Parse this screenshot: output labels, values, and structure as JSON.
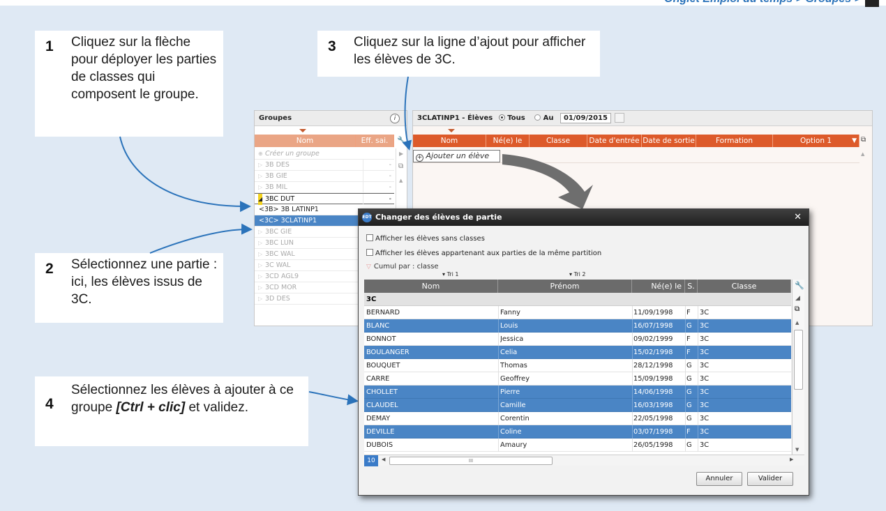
{
  "header": {
    "breadcrumb": "Onglet Emploi du temps > Groupes >"
  },
  "callouts": [
    {
      "num": "1",
      "text": "Cliquez sur la flèche pour déployer les parties de classes qui composent le groupe."
    },
    {
      "num": "2",
      "text": "Sélectionnez une partie : ici, les élèves issus de 3C."
    },
    {
      "num": "3",
      "text": "Cliquez sur la ligne d’ajout pour afficher les élèves de 3C."
    },
    {
      "num": "4",
      "text_before": "Sélectionnez les élèves à ajouter à ce groupe ",
      "text_bold": "[Ctrl + clic]",
      "text_after": " et validez."
    }
  ],
  "groups_panel": {
    "title": "Groupes",
    "col_nom": "Nom",
    "col_eff": "Eff. sai.",
    "create": "Créer un groupe",
    "rows": [
      {
        "name": "3B DES",
        "eff": "-"
      },
      {
        "name": "3B GIE",
        "eff": "-"
      },
      {
        "name": "3B MIL",
        "eff": "-"
      },
      {
        "name": "3BC DUT",
        "eff": "-"
      },
      {
        "name": "<3B> 3B  LATINP1",
        "eff": ""
      },
      {
        "name": "<3C> 3CLATINP1",
        "eff": ""
      },
      {
        "name": "3BC GIE",
        "eff": ""
      },
      {
        "name": "3BC LUN",
        "eff": ""
      },
      {
        "name": "3BC WAL",
        "eff": ""
      },
      {
        "name": "3C WAL",
        "eff": ""
      },
      {
        "name": "3CD AGL9",
        "eff": ""
      },
      {
        "name": "3CD MOR",
        "eff": ""
      },
      {
        "name": "3D DES",
        "eff": ""
      }
    ]
  },
  "students_panel": {
    "title": "3CLATINP1 - Élèves",
    "radio_tous": "Tous",
    "radio_au": "Au",
    "date": "01/09/2015",
    "columns": [
      "Nom",
      "Né(e) le",
      "Classe",
      "Date d'entrée",
      "Date de sortie",
      "Formation",
      "Option 1"
    ],
    "add_row": "Ajouter un élève"
  },
  "dialog": {
    "title": "Changer des élèves de partie",
    "logo": "EDT",
    "check1": "Afficher les élèves sans classes",
    "check2": "Afficher les élèves appartenant aux parties de la même partition",
    "cumul": "Cumul par : classe",
    "tri1": "Tri 1",
    "tri2": "Tri 2",
    "columns": [
      "Nom",
      "Prénom",
      "Né(e) le",
      "S.",
      "Classe"
    ],
    "group_label": "3C",
    "rows": [
      {
        "nom": "BERNARD",
        "prenom": "Fanny",
        "ne": "11/09/1998",
        "s": "F",
        "classe": "3C",
        "selected": false
      },
      {
        "nom": "BLANC",
        "prenom": "Louis",
        "ne": "16/07/1998",
        "s": "G",
        "classe": "3C",
        "selected": true
      },
      {
        "nom": "BONNOT",
        "prenom": "Jessica",
        "ne": "09/02/1999",
        "s": "F",
        "classe": "3C",
        "selected": false
      },
      {
        "nom": "BOULANGER",
        "prenom": "Celia",
        "ne": "15/02/1998",
        "s": "F",
        "classe": "3C",
        "selected": true
      },
      {
        "nom": "BOUQUET",
        "prenom": "Thomas",
        "ne": "28/12/1998",
        "s": "G",
        "classe": "3C",
        "selected": false
      },
      {
        "nom": "CARRE",
        "prenom": "Geoffrey",
        "ne": "15/09/1998",
        "s": "G",
        "classe": "3C",
        "selected": false
      },
      {
        "nom": "CHOLLET",
        "prenom": "Pierre",
        "ne": "14/06/1998",
        "s": "G",
        "classe": "3C",
        "selected": true
      },
      {
        "nom": "CLAUDEL",
        "prenom": "Camille",
        "ne": "16/03/1998",
        "s": "G",
        "classe": "3C",
        "selected": true
      },
      {
        "nom": "DEMAY",
        "prenom": "Corentin",
        "ne": "22/05/1998",
        "s": "G",
        "classe": "3C",
        "selected": false
      },
      {
        "nom": "DEVILLE",
        "prenom": "Coline",
        "ne": "03/07/1998",
        "s": "F",
        "classe": "3C",
        "selected": true
      },
      {
        "nom": "DUBOIS",
        "prenom": "Amaury",
        "ne": "26/05/1998",
        "s": "G",
        "classe": "3C",
        "selected": false
      }
    ],
    "count": "10",
    "scroll_mark": "III",
    "cancel": "Annuler",
    "validate": "Valider"
  }
}
